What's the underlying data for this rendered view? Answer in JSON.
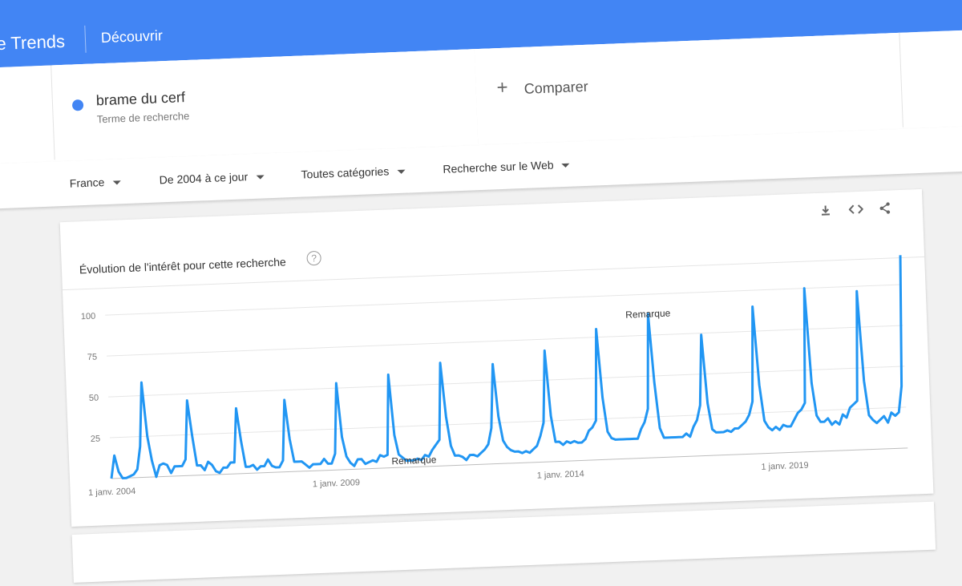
{
  "app": {
    "logo": "ogle Trends",
    "nav": "Découvrir"
  },
  "search": {
    "term": "brame du cerf",
    "term_type": "Terme de recherche",
    "term_color": "#4285f4",
    "compare_label": "Comparer"
  },
  "filters": {
    "region": "France",
    "period": "De 2004 à ce jour",
    "category": "Toutes catégories",
    "type": "Recherche sur le Web"
  },
  "chart_card": {
    "title": "Évolution de l'intérêt pour cette recherche",
    "help": "?",
    "icons": [
      "download-icon",
      "embed-icon",
      "share-icon"
    ]
  },
  "chart_data": {
    "type": "line",
    "title": "Évolution de l'intérêt pour cette recherche",
    "xlabel": "",
    "ylabel": "",
    "ylim": [
      0,
      100
    ],
    "yticks": [
      25,
      50,
      75,
      100
    ],
    "x_tick_labels": [
      "1 janv. 2004",
      "1 janv. 2009",
      "1 janv. 2014",
      "1 janv. 2019"
    ],
    "x_tick_indices": [
      0,
      60,
      120,
      180
    ],
    "annotations": [
      {
        "text": "Remarque",
        "index": 81
      },
      {
        "text": "Remarque",
        "index": 145
      }
    ],
    "grid": true,
    "series_color": "#2196f3",
    "series": [
      {
        "values": [
          0,
          14,
          4,
          0,
          0,
          1,
          2,
          5,
          19,
          58,
          25,
          10,
          0,
          7,
          8,
          7,
          2,
          6,
          6,
          6,
          10,
          46,
          24,
          6,
          6,
          3,
          8,
          6,
          2,
          1,
          4,
          4,
          7,
          7,
          40,
          20,
          4,
          4,
          5,
          2,
          4,
          4,
          8,
          4,
          3,
          3,
          7,
          44,
          20,
          6,
          6,
          6,
          4,
          2,
          4,
          4,
          4,
          7,
          4,
          4,
          10,
          53,
          20,
          8,
          4,
          2,
          6,
          6,
          3,
          4,
          5,
          4,
          8,
          7,
          8,
          57,
          20,
          8,
          6,
          4,
          4,
          4,
          5,
          4,
          7,
          6,
          10,
          13,
          16,
          63,
          30,
          12,
          6,
          6,
          5,
          3,
          6,
          6,
          5,
          7,
          9,
          12,
          22,
          61,
          29,
          14,
          10,
          8,
          7,
          7,
          6,
          7,
          6,
          8,
          10,
          16,
          24,
          68,
          28,
          12,
          12,
          10,
          12,
          11,
          12,
          11,
          11,
          13,
          18,
          20,
          24,
          80,
          38,
          17,
          13,
          12,
          12,
          12,
          12,
          12,
          12,
          12,
          18,
          22,
          30,
          88,
          46,
          18,
          12,
          12,
          12,
          12,
          12,
          12,
          14,
          12,
          18,
          22,
          31,
          74,
          32,
          16,
          14,
          14,
          14,
          15,
          14,
          16,
          16,
          18,
          20,
          24,
          32,
          90,
          42,
          20,
          16,
          14,
          16,
          14,
          17,
          16,
          16,
          20,
          24,
          26,
          30,
          100,
          42,
          22,
          18,
          18,
          20,
          16,
          18,
          16,
          22,
          20,
          26,
          28,
          30,
          97,
          42,
          21,
          18,
          16,
          18,
          20,
          16,
          22,
          20,
          22,
          38,
          118
        ]
      }
    ]
  }
}
